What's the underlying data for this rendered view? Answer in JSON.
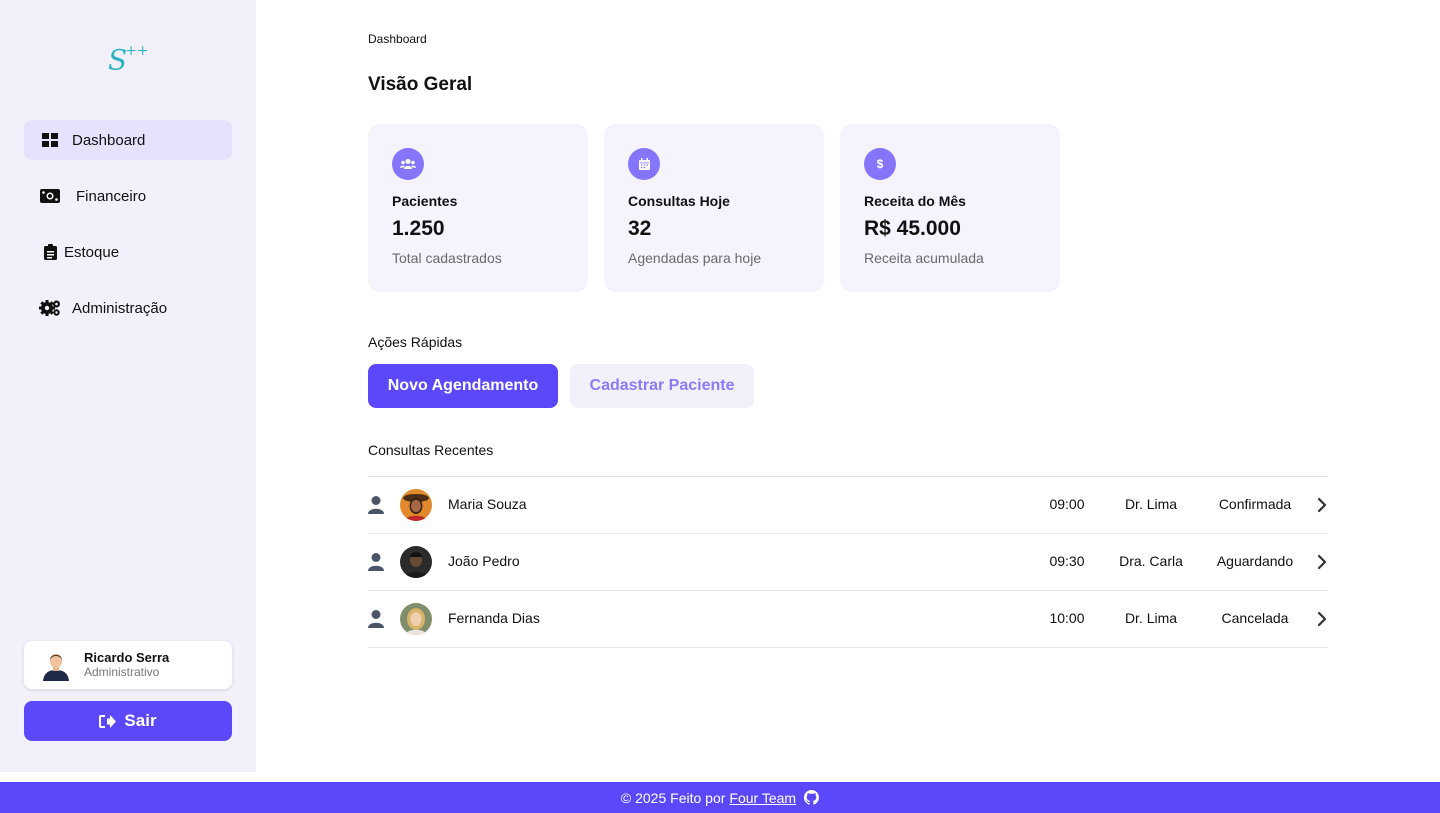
{
  "sidebar": {
    "logo_text": "S",
    "logo_sup": "++",
    "items": [
      {
        "label": "Dashboard",
        "icon": "grid-icon",
        "active": true
      },
      {
        "label": "Financeiro",
        "icon": "money-bill-icon"
      },
      {
        "label": "Estoque",
        "icon": "clipboard-icon"
      },
      {
        "label": "Administração",
        "icon": "gears-icon"
      }
    ],
    "user": {
      "name": "Ricardo Serra",
      "role": "Administrativo"
    },
    "logout_label": "Sair"
  },
  "header": {
    "breadcrumb": "Dashboard",
    "title": "Visão Geral"
  },
  "stats": [
    {
      "title": "Pacientes",
      "value": "1.250",
      "subtitle": "Total cadastrados",
      "icon": "users-icon"
    },
    {
      "title": "Consultas Hoje",
      "value": "32",
      "subtitle": "Agendadas para hoje",
      "icon": "calendar-icon"
    },
    {
      "title": "Receita do Mês",
      "value": "R$ 45.000",
      "subtitle": "Receita acumulada",
      "icon": "dollar-icon"
    }
  ],
  "quick_actions": {
    "label": "Ações Rápidas",
    "primary": "Novo Agendamento",
    "secondary": "Cadastrar Paciente"
  },
  "recent": {
    "label": "Consultas Recentes",
    "rows": [
      {
        "patient": "Maria Souza",
        "time": "09:00",
        "doctor": "Dr. Lima",
        "status": "Confirmada"
      },
      {
        "patient": "João Pedro",
        "time": "09:30",
        "doctor": "Dra. Carla",
        "status": "Aguardando"
      },
      {
        "patient": "Fernanda Dias",
        "time": "10:00",
        "doctor": "Dr. Lima",
        "status": "Cancelada"
      }
    ]
  },
  "footer": {
    "text": "© 2025 Feito por",
    "link": "Four Team"
  },
  "colors": {
    "accent": "#5b48fa",
    "sidebar_bg": "#f2f1fb",
    "card_bg": "#f4f3fe",
    "icon_circle": "#8475fb"
  }
}
